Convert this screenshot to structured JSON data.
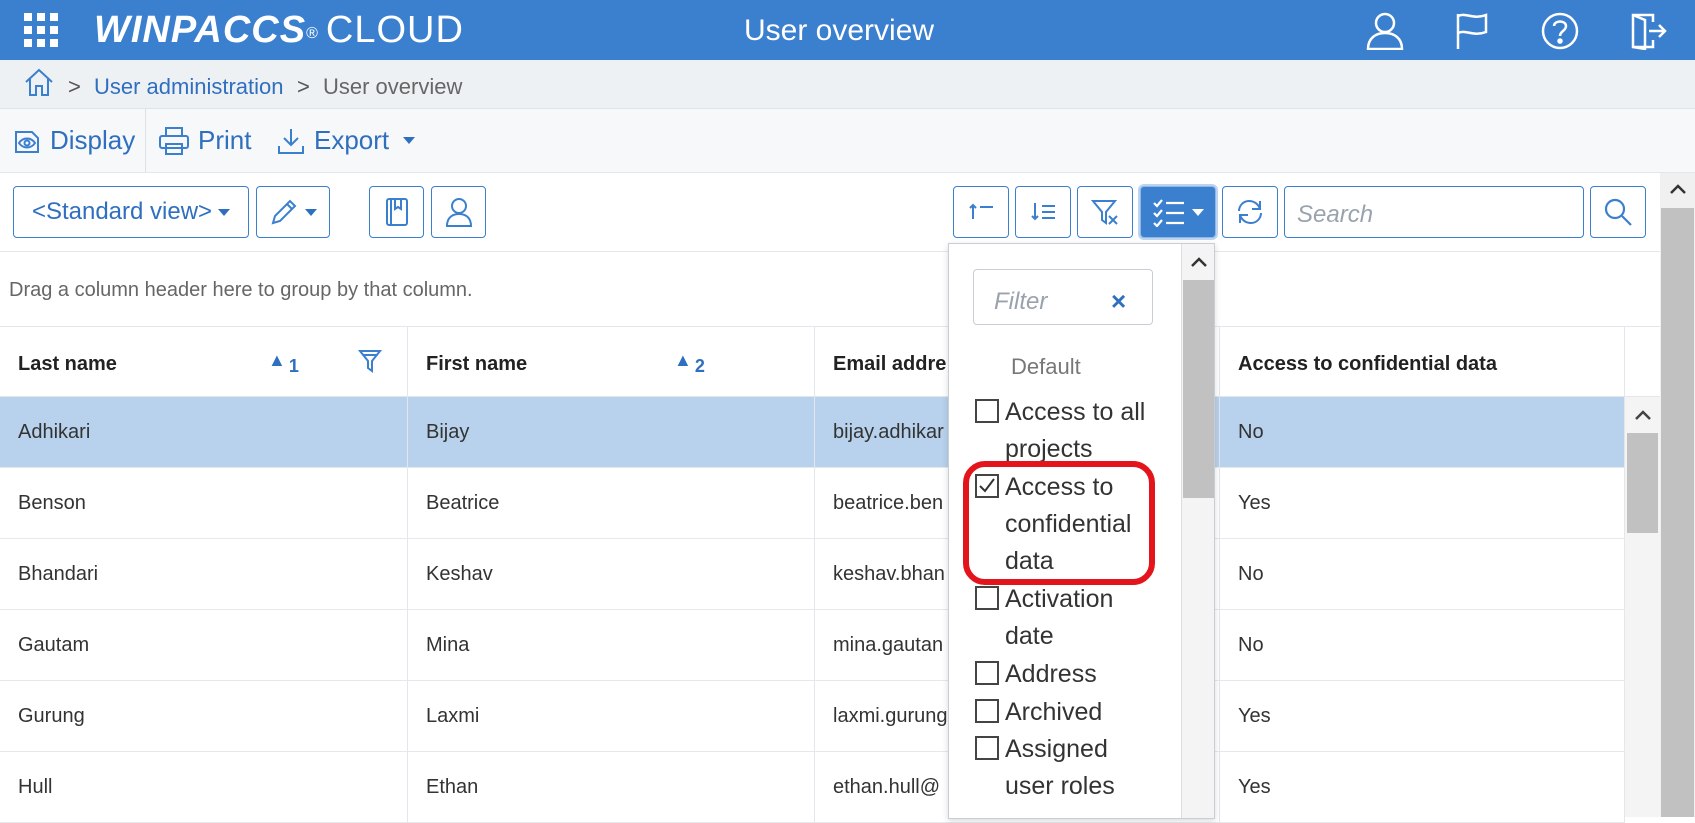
{
  "app": {
    "brand_bold": "WINPACCS",
    "brand_reg": "®",
    "brand_cloud": "CLOUD",
    "title": "User overview"
  },
  "breadcrumb": {
    "sep": ">",
    "items": [
      "User administration",
      "User overview"
    ]
  },
  "menu": {
    "display": "Display",
    "print": "Print",
    "export": "Export"
  },
  "toolbar": {
    "view": "<Standard view>",
    "search_placeholder": "Search"
  },
  "table": {
    "group_hint": "Drag a column header here to group by that column.",
    "columns": [
      {
        "label": "Last name",
        "sort": "1"
      },
      {
        "label": "First name",
        "sort": "2"
      },
      {
        "label": "Email addre"
      },
      {
        "label": "Access to confidential data"
      }
    ],
    "rows": [
      [
        "Adhikari",
        "Bijay",
        "bijay.adhikar",
        "No"
      ],
      [
        "Benson",
        "Beatrice",
        "beatrice.ben",
        "Yes"
      ],
      [
        "Bhandari",
        "Keshav",
        "keshav.bhan",
        "No"
      ],
      [
        "Gautam",
        "Mina",
        "mina.gautan",
        "No"
      ],
      [
        "Gurung",
        "Laxmi",
        "laxmi.gurung",
        "Yes"
      ],
      [
        "Hull",
        "Ethan",
        "ethan.hull@",
        "Yes"
      ]
    ]
  },
  "column_chooser": {
    "filter_placeholder": "Filter",
    "clear": "×",
    "group": "Default",
    "options": [
      {
        "line1": "Access to all",
        "line2": "projects",
        "checked": false
      },
      {
        "line1": "Access to",
        "line2": "confidential",
        "line3": "data",
        "checked": true
      },
      {
        "line1": "Activation",
        "line2": "date",
        "checked": false
      },
      {
        "line1": "Address",
        "checked": false
      },
      {
        "line1": "Archived",
        "checked": false
      },
      {
        "line1": "Assigned",
        "line2": "user roles",
        "checked": false
      }
    ]
  },
  "colors": {
    "primary": "#3b7fcf",
    "selected_row": "#b8d1ec",
    "highlight": "#e3141b"
  }
}
